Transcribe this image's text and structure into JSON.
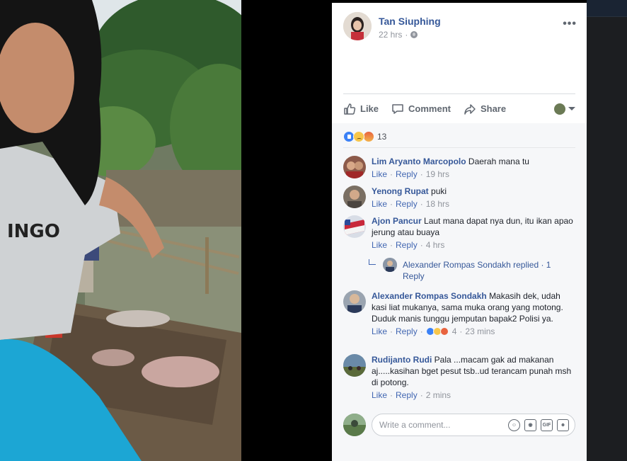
{
  "post": {
    "author": "Tan Siuphing",
    "time": "22 hrs",
    "more": "•••"
  },
  "actions": {
    "like": "Like",
    "comment": "Comment",
    "share": "Share"
  },
  "reactions": {
    "count": "13",
    "types": [
      "like",
      "sad",
      "angry"
    ]
  },
  "comments": [
    {
      "name": "Lim Aryanto Marcopolo",
      "text": "Daerah mana tu",
      "like": "Like",
      "reply": "Reply",
      "time": "19 hrs"
    },
    {
      "name": "Yenong Rupat",
      "text": "puki",
      "like": "Like",
      "reply": "Reply",
      "time": "18 hrs"
    },
    {
      "name": "Ajon Pancur",
      "text": "Laut mana dapat nya dun, itu ikan apao jerung atau buaya",
      "like": "Like",
      "reply": "Reply",
      "time": "4 hrs"
    },
    {
      "name": "Alexander Rompas Sondakh",
      "text": "Makasih dek, udah kasi liat mukanya, sama muka orang yang motong. Duduk manis tunggu jemputan bapak2 Polisi ya.",
      "like": "Like",
      "reply": "Reply",
      "reactions": "4",
      "time": "23 mins"
    },
    {
      "name": "Rudijanto Rudi",
      "text": "Pala ...macam gak ad makanan aj.....kasihan bget pesut tsb..ud terancam punah msh di potong.",
      "like": "Like",
      "reply": "Reply",
      "time": "2 mins"
    }
  ],
  "reply_thread": {
    "text": "Alexander Rompas Sondakh replied · 1 Reply"
  },
  "composer": {
    "placeholder": "Write a comment...",
    "icons": [
      "emoji-icon",
      "camera-icon",
      "gif-icon",
      "sticker-icon"
    ],
    "gif_label": "GIF"
  }
}
